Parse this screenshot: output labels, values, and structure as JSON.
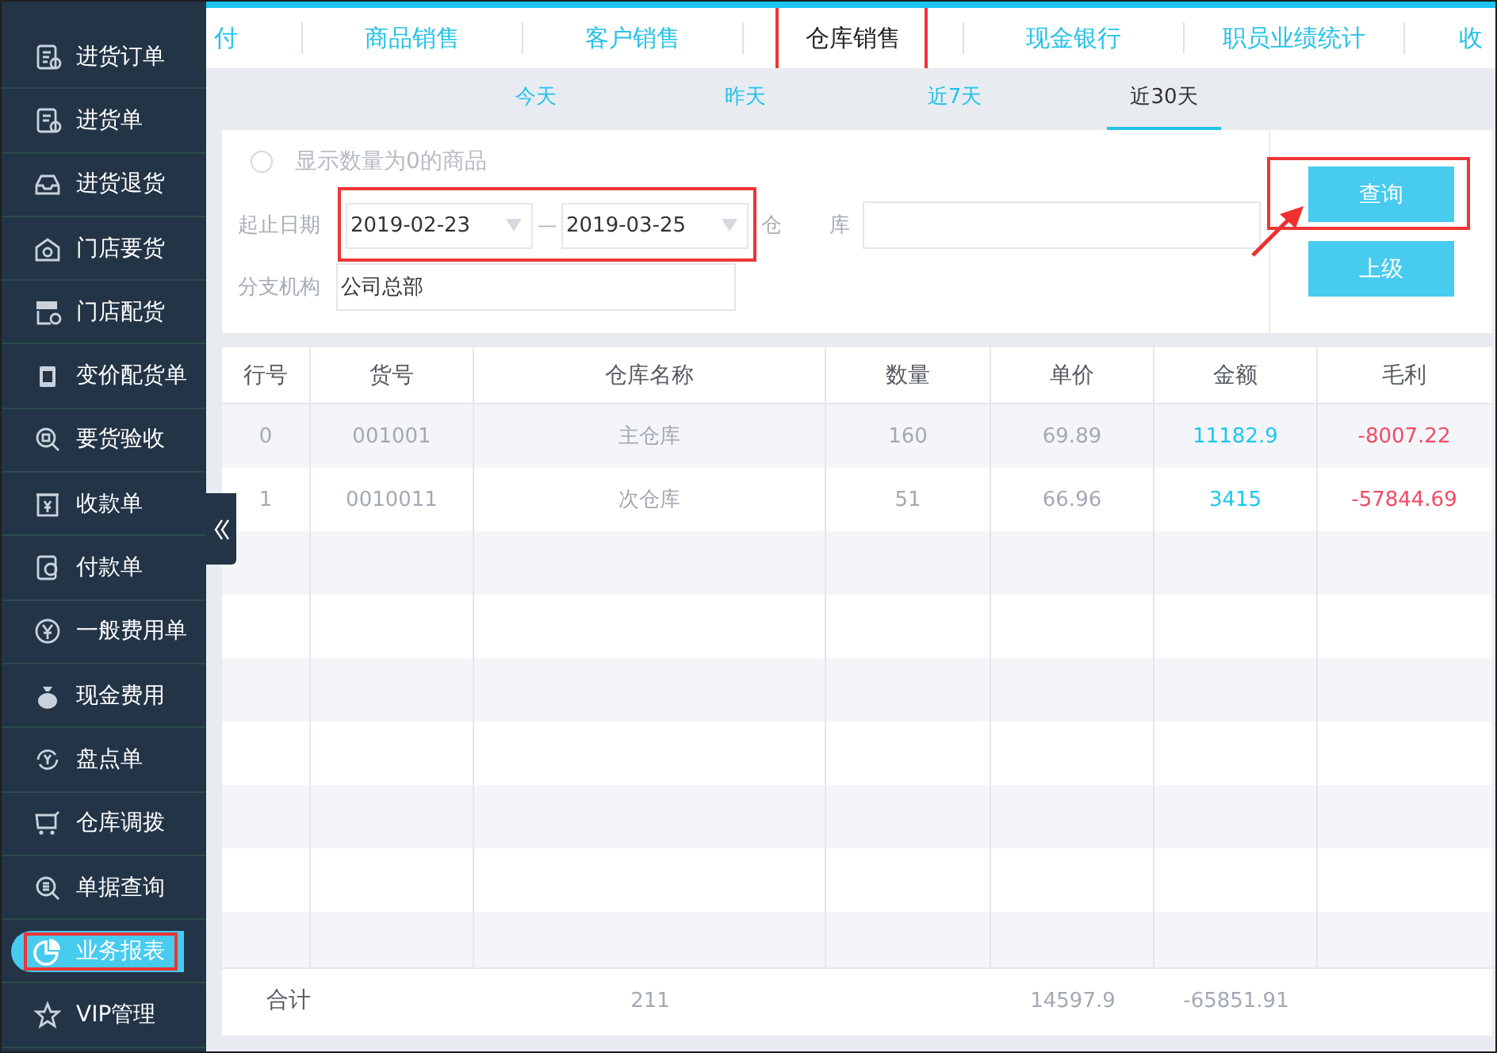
{
  "sidebar": {
    "items": [
      {
        "label": "进货订单",
        "selected": false,
        "highlighted": false
      },
      {
        "label": "进货单",
        "selected": false,
        "highlighted": false
      },
      {
        "label": "进货退货",
        "selected": false,
        "highlighted": false
      },
      {
        "label": "门店要货",
        "selected": false,
        "highlighted": false
      },
      {
        "label": "门店配货",
        "selected": false,
        "highlighted": false
      },
      {
        "label": "变价配货单",
        "selected": false,
        "highlighted": false
      },
      {
        "label": "要货验收",
        "selected": false,
        "highlighted": false
      },
      {
        "label": "收款单",
        "selected": false,
        "highlighted": false
      },
      {
        "label": "付款单",
        "selected": false,
        "highlighted": false
      },
      {
        "label": "一般费用单",
        "selected": false,
        "highlighted": false
      },
      {
        "label": "现金费用",
        "selected": false,
        "highlighted": false
      },
      {
        "label": "盘点单",
        "selected": false,
        "highlighted": false
      },
      {
        "label": "仓库调拨",
        "selected": false,
        "highlighted": false
      },
      {
        "label": "单据查询",
        "selected": false,
        "highlighted": false
      },
      {
        "label": "业务报表",
        "selected": true,
        "highlighted": true
      },
      {
        "label": "VIP管理",
        "selected": false,
        "highlighted": false
      }
    ]
  },
  "report_tabs": [
    {
      "label": "付",
      "selected": false,
      "highlighted": false
    },
    {
      "label": "商品销售",
      "selected": false,
      "highlighted": false
    },
    {
      "label": "客户销售",
      "selected": false,
      "highlighted": false
    },
    {
      "label": "仓库销售",
      "selected": true,
      "highlighted": true
    },
    {
      "label": "现金银行",
      "selected": false,
      "highlighted": false
    },
    {
      "label": "职员业绩统计",
      "selected": false,
      "highlighted": false
    },
    {
      "label": "收",
      "selected": false,
      "highlighted": false
    }
  ],
  "period_tabs": [
    {
      "label": "今天",
      "selected": false
    },
    {
      "label": "昨天",
      "selected": false
    },
    {
      "label": "近7天",
      "selected": false
    },
    {
      "label": "近30天",
      "selected": true
    }
  ],
  "filters": {
    "zero_quantity": {
      "label": "显示数量为0的商品",
      "checked": false
    },
    "date_label": "起止日期",
    "date_from": "2019-02-23",
    "date_separator": "—",
    "date_to": "2019-03-25",
    "dates_highlighted": true,
    "warehouse_label": "仓 库",
    "branch_label": "分支机构",
    "branch_value": "公司总部"
  },
  "buttons": [
    {
      "label": "查询",
      "highlighted": true,
      "pointed": true
    },
    {
      "label": "上级",
      "highlighted": false,
      "pointed": false
    }
  ],
  "table": {
    "columns": [
      {
        "label": "行号",
        "kind": "plain"
      },
      {
        "label": "货号",
        "kind": "plain"
      },
      {
        "label": "仓库名称",
        "kind": "plain"
      },
      {
        "label": "数量",
        "kind": "plain"
      },
      {
        "label": "单价",
        "kind": "plain"
      },
      {
        "label": "金额",
        "kind": "amount"
      },
      {
        "label": "毛利",
        "kind": "profit"
      }
    ],
    "rows": [
      [
        "0",
        "001001",
        "主仓库",
        "160",
        "69.89",
        "11182.9",
        "-8007.22"
      ],
      [
        "1",
        "0010011",
        "次仓库",
        "51",
        "66.96",
        "3415",
        "-57844.69"
      ]
    ],
    "totals": {
      "label": "合计",
      "quantity": "211",
      "amount": "14597.9",
      "profit": "-65851.91"
    }
  }
}
